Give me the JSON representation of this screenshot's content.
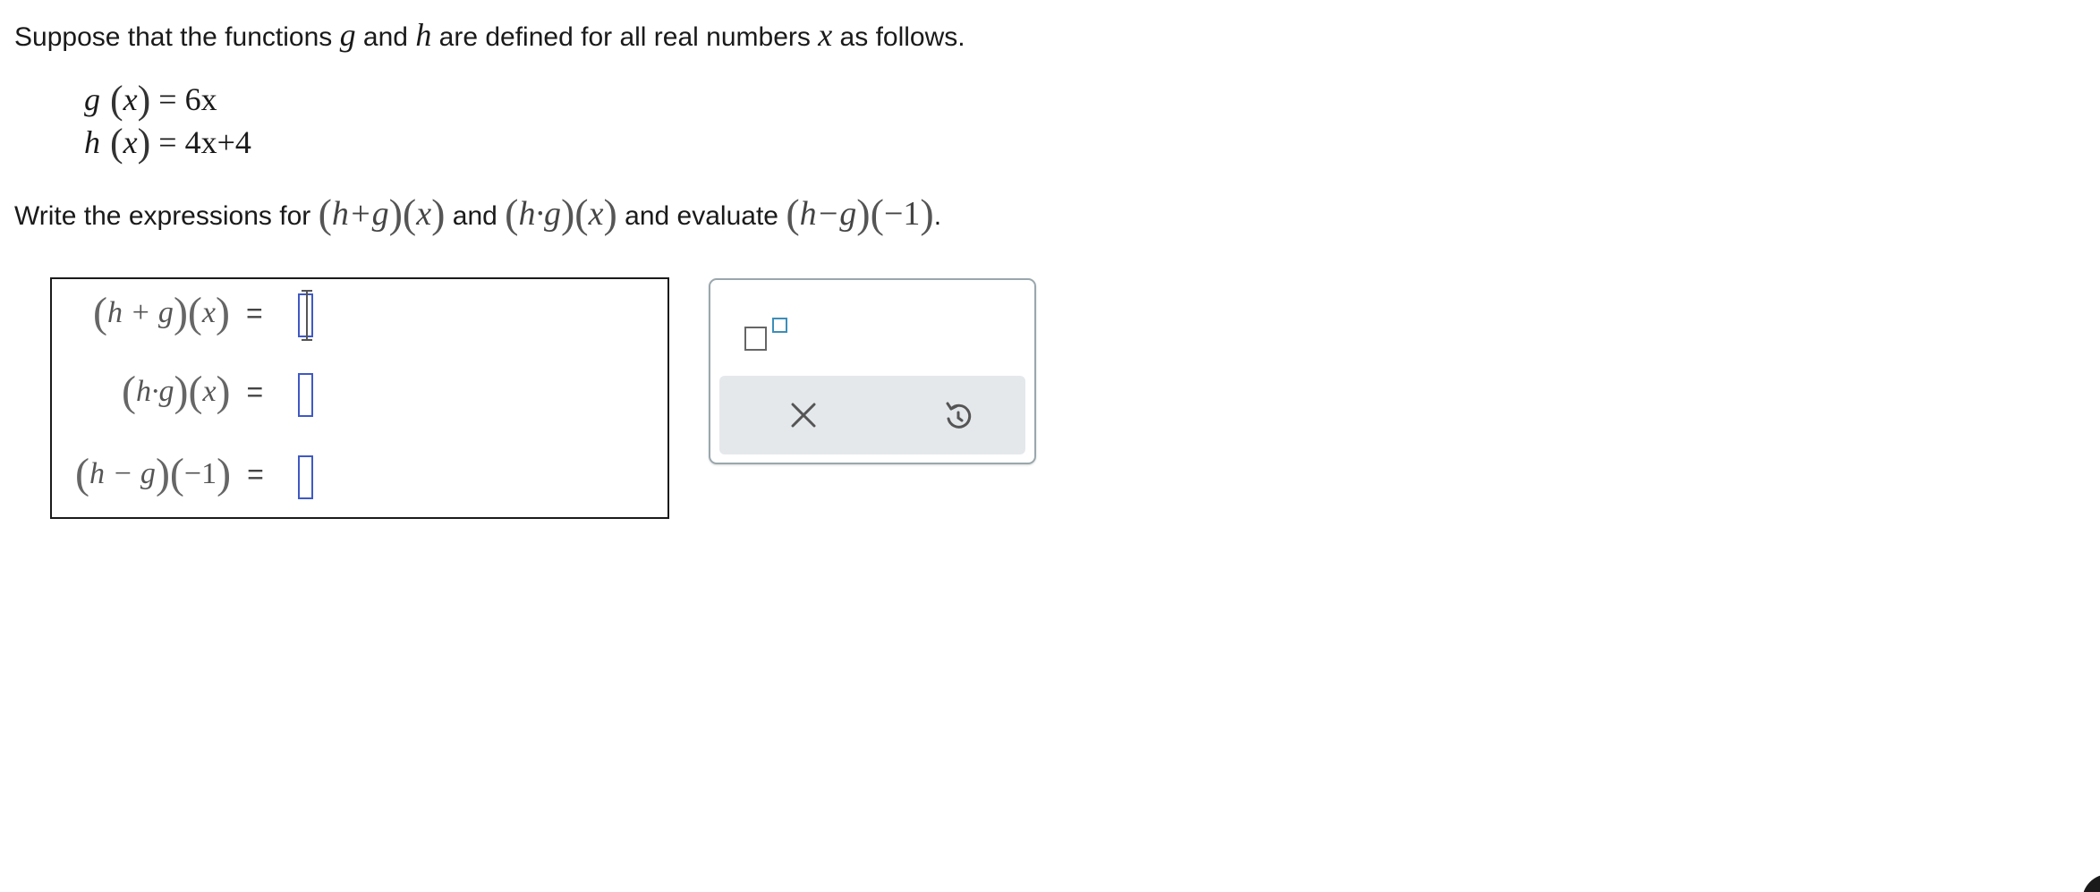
{
  "problem": {
    "intro_part1": "Suppose that the functions ",
    "var_g": "g",
    "intro_and": " and ",
    "var_h": "h",
    "intro_part2": " are defined for all real numbers ",
    "var_x": "x",
    "intro_part3": " as follows."
  },
  "definitions": {
    "g_lhs_name": "g",
    "g_arg": "x",
    "g_rhs": "6x",
    "h_lhs_name": "h",
    "h_arg": "x",
    "h_rhs": "4x+4"
  },
  "instruction": {
    "prefix": "Write the expressions for ",
    "expr1": "h+g",
    "expr1_arg": "x",
    "mid": " and ",
    "expr2": "h·g",
    "expr2_arg": "x",
    "mid2": " and evaluate ",
    "expr3": "h−g",
    "expr3_arg": "−1",
    "suffix": "."
  },
  "answers": [
    {
      "label_fn": "h + g",
      "label_arg": "x",
      "equals": "=",
      "value": ""
    },
    {
      "label_fn": "h·g",
      "label_arg": "x",
      "equals": "=",
      "value": ""
    },
    {
      "label_fn": "h − g",
      "label_arg": "−1",
      "equals": "=",
      "value": ""
    }
  ],
  "tools": {
    "superscript_icon": "superscript-box-icon",
    "clear_icon": "x-icon",
    "undo_icon": "undo-icon",
    "accent_color": "#3f59c4",
    "superscript_accent": "#3c8eb8",
    "action_bar_color": "#e4e8eb"
  }
}
